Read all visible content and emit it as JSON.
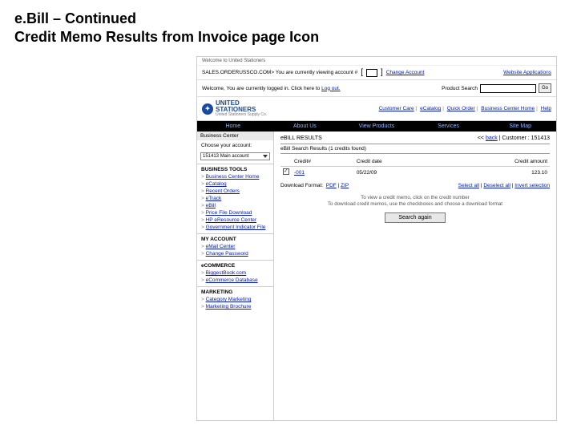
{
  "slide": {
    "title_l1": "e.Bill – Continued",
    "title_l2": "Credit Memo Results from Invoice page Icon"
  },
  "topstrip": {
    "welcome": "Welcome to United Stationers"
  },
  "addrbar": {
    "text": "SALES.ORDERUSSCO.COM> You are currently viewing account #",
    "change": "Change Account",
    "apps": "Website Applications"
  },
  "welcome": {
    "msg_a": "Welcome, You are currently logged in.  Click here to ",
    "logout": "Log out.",
    "search_label": "Product Search",
    "go": "Go"
  },
  "brand": {
    "l1": "UNITED",
    "l2": "STATIONERS",
    "sub": "United Stationers Supply Co."
  },
  "toplinks": {
    "a": "Customer Care",
    "b": "eCatalog",
    "c": "Quick Order",
    "d": "Business Center Home",
    "e": "Help"
  },
  "nav": {
    "a": "Home",
    "b": "About Us",
    "c": "View Products",
    "d": "Services",
    "e": "Site Map"
  },
  "sidebar": {
    "hdr": "Business Center",
    "choose": "Choose your account:",
    "acct": "151413 Main account",
    "tools_title": "BUSINESS TOOLS",
    "tools": [
      "Business Center Home",
      "eCatalog",
      "Recent Orders",
      "eTrack",
      "eBill",
      "Price File Download",
      "HP eResource Center",
      "Government Indicator File"
    ],
    "myacct_title": "MY ACCOUNT",
    "myacct": [
      "eMail Center",
      "Change Password"
    ],
    "ecom_title": "eCOMMERCE",
    "ecom": [
      "BiggestBook.com",
      "eCommerce Database"
    ],
    "mkt_title": "MARKETING",
    "mkt": [
      "Category Marketing",
      "Marketing Brochure"
    ]
  },
  "main": {
    "title": "eBILL RESULTS",
    "back": "back",
    "cust_label": "Customer :",
    "cust": "151413",
    "sub": "eBill Search Results (1 credits found)",
    "th_credit": "Credit#",
    "th_date": "Credit date",
    "th_amt": "Credit amount",
    "row_credit": "-001",
    "row_date": "05/22/09",
    "row_amt": "123.10",
    "dl_label": "Download Format:",
    "pdf": "PDF",
    "zip": "ZIP",
    "selall": "Select all",
    "deselall": "Deselect all",
    "invsel": "Invert selection",
    "instr1": "To view a credit memo, click on the credit number",
    "instr2": "To download credit memos, use the checkboxes and choose a download format",
    "again": "Search again"
  }
}
